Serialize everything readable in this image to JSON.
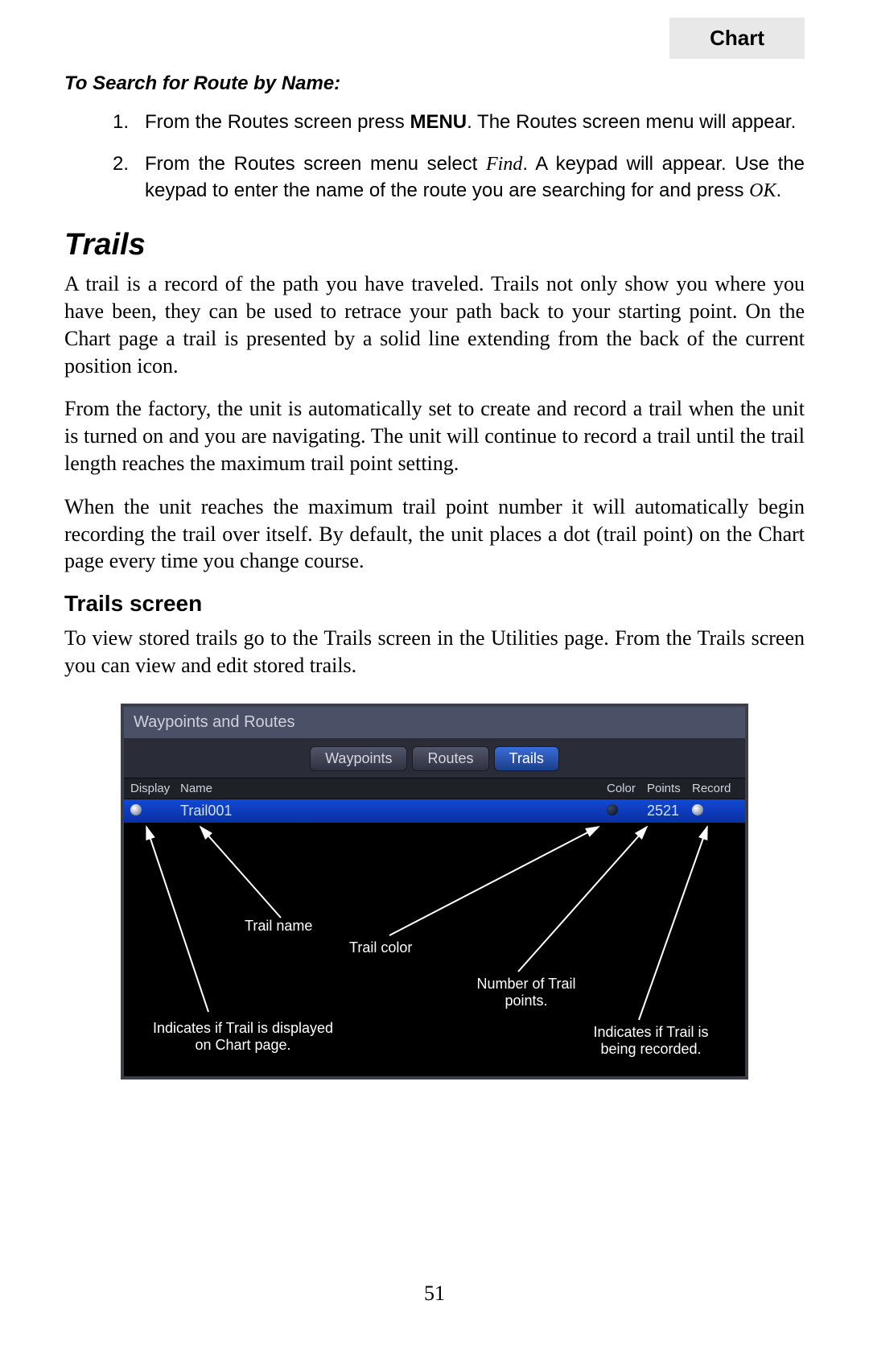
{
  "header": {
    "tab": "Chart"
  },
  "search_section": {
    "title": "To Search for Route by Name:",
    "steps": [
      {
        "num": "1.",
        "pre": "From the Routes screen press ",
        "bold": "MENU",
        "post": ". The Routes screen menu will appear."
      },
      {
        "num": "2.",
        "pre": "From the Routes screen menu select ",
        "ital": "Find",
        "mid": ". A keypad will appear. Use the keypad to enter the name of the route you are searching for and press ",
        "ital2": "OK",
        "post": "."
      }
    ]
  },
  "trails": {
    "heading": "Trails",
    "p1": "A trail is a record of the path you have traveled. Trails not only show you where you have been, they can be used to retrace your path back to your starting point. On the Chart page a trail is presented by a solid line extending from the back of the current position icon.",
    "p2": "From the factory, the unit is automatically set to create and record a trail when the unit is turned on and you are navigating. The unit will continue to record a trail until the trail length reaches the maximum trail point setting.",
    "p3": "When the unit reaches the maximum trail point number it will automatically begin recording the trail over itself. By default, the unit places a dot (trail point) on the Chart page every time you change course."
  },
  "trails_screen": {
    "heading": "Trails screen",
    "p1": "To view stored trails go to the Trails screen in the Utilities page. From the Trails screen you can view and edit stored trails."
  },
  "device": {
    "title": "Waypoints and Routes",
    "tabs": [
      "Waypoints",
      "Routes",
      "Trails"
    ],
    "active_tab": 2,
    "columns": {
      "display": "Display",
      "name": "Name",
      "color": "Color",
      "points": "Points",
      "record": "Record"
    },
    "row": {
      "name": "Trail001",
      "points": "2521"
    },
    "annotations": {
      "trail_name": "Trail name",
      "trail_color": "Trail color",
      "num_points_l1": "Number of Trail",
      "num_points_l2": "points.",
      "display_l1": "Indicates if Trail is displayed",
      "display_l2": "on Chart page.",
      "record_l1": "Indicates if Trail is",
      "record_l2": "being recorded."
    }
  },
  "page_number": "51"
}
